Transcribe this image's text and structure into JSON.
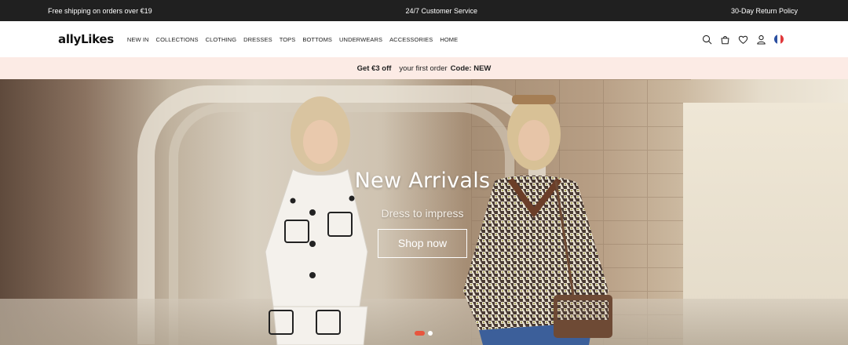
{
  "topbar": {
    "left": "Free shipping on orders over €19",
    "center": "24/7 Customer Service",
    "right": "30-Day Return Policy"
  },
  "header": {
    "logo": "allyLikes",
    "nav": [
      "NEW IN",
      "COLLECTIONS",
      "CLOTHING",
      "DRESSES",
      "TOPS",
      "BOTTOMS",
      "UNDERWEARS",
      "ACCESSORIES",
      "HOME"
    ],
    "icons": [
      "search-icon",
      "bag-icon",
      "heart-icon",
      "user-icon",
      "flag-fr-icon"
    ]
  },
  "promo": {
    "offer": "Get €3 off",
    "middle": "your first order",
    "code": "Code: NEW"
  },
  "hero": {
    "title": "New Arrivals",
    "subtitle": "Dress to impress",
    "button": "Shop now",
    "slides": 2,
    "active_slide": 1
  },
  "colors": {
    "topbar_bg": "#202020",
    "promo_bg": "#fcebe5",
    "dot_active": "#e8553e"
  }
}
